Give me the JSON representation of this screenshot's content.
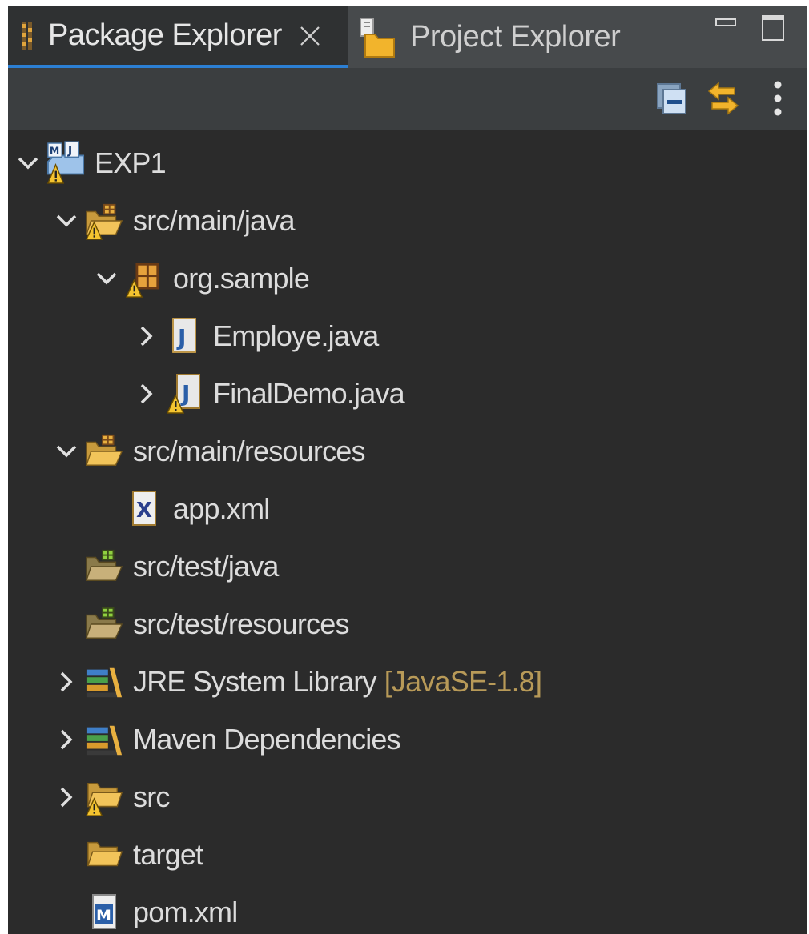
{
  "tabs": [
    {
      "label": "Package Explorer",
      "active": true
    },
    {
      "label": "Project Explorer",
      "active": false
    }
  ],
  "colors": {
    "panel_bg": "#2b2b2b",
    "tabbar_bg": "#474a4c",
    "active_tab_underline": "#2c7fd3",
    "text": "#dcdcdc",
    "decoration_text": "#b89a58"
  },
  "tree": {
    "project": {
      "label": "EXP1",
      "icon": "maven-java-project-icon",
      "expanded": true
    },
    "src_main_java": {
      "label": "src/main/java",
      "icon": "source-folder-warning-icon",
      "expanded": true
    },
    "org_sample": {
      "label": "org.sample",
      "icon": "package-warning-icon",
      "expanded": true
    },
    "employe": {
      "label": "Employe.java",
      "icon": "java-file-icon",
      "expanded": false
    },
    "finaldemo": {
      "label": "FinalDemo.java",
      "icon": "java-file-warning-icon",
      "expanded": false
    },
    "src_main_resources": {
      "label": "src/main/resources",
      "icon": "source-folder-icon",
      "expanded": true
    },
    "app_xml": {
      "label": "app.xml",
      "icon": "xml-file-icon"
    },
    "src_test_java": {
      "label": "src/test/java",
      "icon": "empty-source-folder-icon"
    },
    "src_test_resources": {
      "label": "src/test/resources",
      "icon": "empty-source-folder-icon"
    },
    "jre": {
      "label": "JRE System Library",
      "decoration": "[JavaSE-1.8]",
      "icon": "library-icon",
      "expanded": false
    },
    "maven_deps": {
      "label": "Maven Dependencies",
      "icon": "library-icon",
      "expanded": false
    },
    "src": {
      "label": "src",
      "icon": "folder-warning-icon",
      "expanded": false
    },
    "target": {
      "label": "target",
      "icon": "folder-icon"
    },
    "pom": {
      "label": "pom.xml",
      "icon": "maven-pom-icon"
    }
  }
}
